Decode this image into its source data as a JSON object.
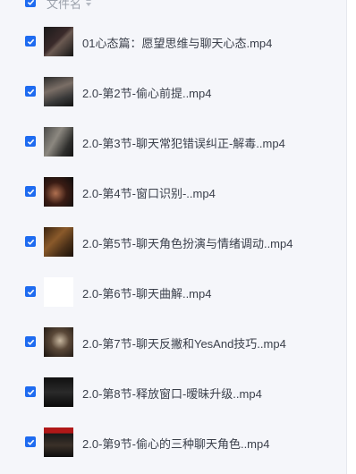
{
  "header": {
    "name_label": "文件名"
  },
  "files": [
    {
      "name": "01心态篇：愿望思维与聊天心态.mp4",
      "thumb": "dark-video-thumbnail"
    },
    {
      "name": "2.0-第2节-偷心前提..mp4",
      "thumb": "dark-video-thumbnail"
    },
    {
      "name": "2.0-第3节-聊天常犯错误纠正-解毒..mp4",
      "thumb": "dark-video-thumbnail"
    },
    {
      "name": "2.0-第4节-窗口识别-..mp4",
      "thumb": "dark-video-thumbnail"
    },
    {
      "name": "2.0-第5节-聊天角色扮演与情绪调动..mp4",
      "thumb": "dark-video-thumbnail"
    },
    {
      "name": "2.0-第6节-聊天曲解..mp4",
      "thumb": "blank-thumbnail"
    },
    {
      "name": "2.0-第7节-聊天反撇和YesAnd技巧..mp4",
      "thumb": "dark-video-thumbnail"
    },
    {
      "name": "2.0-第8节-释放窗口-暧昧升级..mp4",
      "thumb": "dark-video-thumbnail"
    },
    {
      "name": "2.0-第9节-偷心的三种聊天角色..mp4",
      "thumb": "dark-video-thumbnail"
    }
  ],
  "colors": {
    "accent": "#1e6bf0",
    "text": "#3a3f4a",
    "muted": "#9aa0aa",
    "background": "#f5f6fa"
  }
}
